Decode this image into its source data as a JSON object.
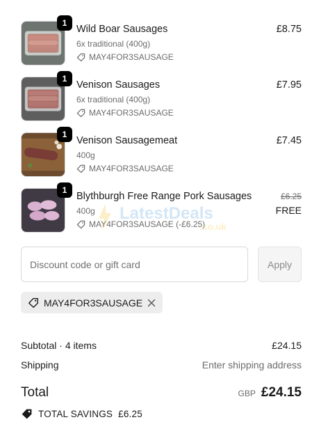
{
  "items": [
    {
      "name": "Wild Boar Sausages",
      "variant": "6x traditional (400g)",
      "discount": "MAY4FOR3SAUSAGE",
      "price": "£8.75",
      "quantity": "1",
      "image_icon": "sausages-tray-icon"
    },
    {
      "name": "Venison Sausages",
      "variant": "6x traditional (400g)",
      "discount": "MAY4FOR3SAUSAGE",
      "price": "£7.95",
      "quantity": "1",
      "image_icon": "sausages-tray-icon"
    },
    {
      "name": "Venison Sausagemeat",
      "variant": "400g",
      "discount": "MAY4FOR3SAUSAGE",
      "price": "£7.45",
      "quantity": "1",
      "image_icon": "sausagemeat-board-icon"
    },
    {
      "name": "Blythburgh Free Range Pork Sausages",
      "variant": "400g",
      "discount": "MAY4FOR3SAUSAGE (-£6.25)",
      "original_price": "£6.25",
      "price": "FREE",
      "quantity": "1",
      "image_icon": "pork-sausages-icon"
    }
  ],
  "watermark": {
    "main": "LatestDeals",
    "sub": ".co.uk"
  },
  "discount": {
    "placeholder": "Discount code or gift card",
    "apply_label": "Apply",
    "applied_code": "MAY4FOR3SAUSAGE"
  },
  "summary": {
    "subtotal_label": "Subtotal · 4 items",
    "subtotal_value": "£24.15",
    "shipping_label": "Shipping",
    "shipping_value": "Enter shipping address",
    "total_label": "Total",
    "currency": "GBP",
    "total_value": "£24.15",
    "savings_label": "TOTAL SAVINGS",
    "savings_value": "£6.25"
  },
  "colors": {
    "accent_badge": "#000000",
    "chip_bg": "#ededed",
    "muted_text": "#6b6b6b"
  }
}
